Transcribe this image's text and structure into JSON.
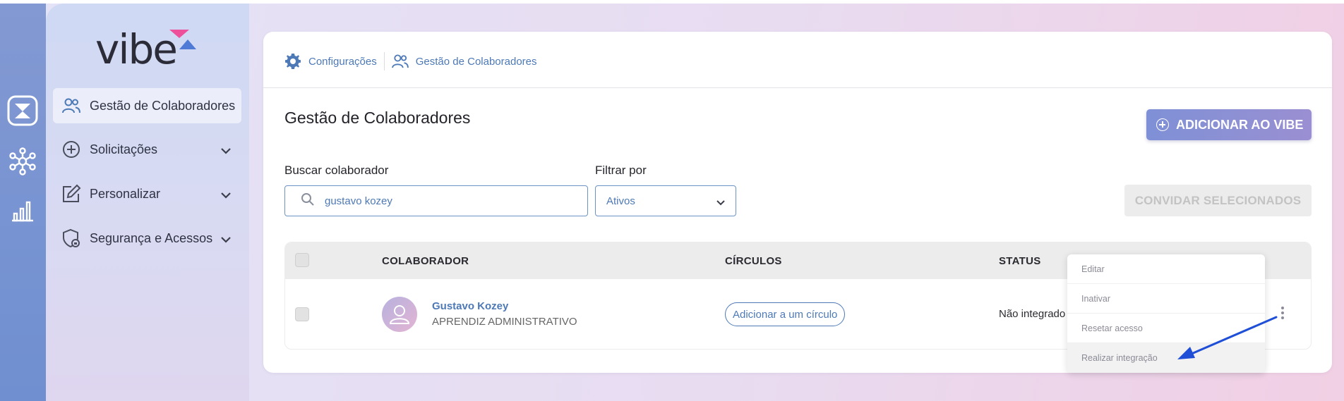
{
  "brand": {
    "logo_text": "vibe"
  },
  "colors": {
    "accent": "#4d79b7",
    "rail": "#7b93d1",
    "primary_button": "#8a90d5",
    "annotation_arrow": "#1f4fd6"
  },
  "rail": {
    "icons": [
      "vibe-hourglass-icon",
      "network-icon",
      "bar-chart-icon"
    ]
  },
  "sidebar": {
    "items": [
      {
        "label": "Gestão de Colaboradores",
        "icon": "users-icon",
        "active": true
      },
      {
        "label": "Solicitações",
        "icon": "plus-circle-icon",
        "expandable": true
      },
      {
        "label": "Personalizar",
        "icon": "edit-icon",
        "expandable": true
      },
      {
        "label": "Segurança e Acessos",
        "icon": "shield-lock-icon",
        "expandable": true
      }
    ]
  },
  "breadcrumb": [
    {
      "label": "Configurações",
      "icon": "gear-icon"
    },
    {
      "label": "Gestão de Colaboradores",
      "icon": "users-icon"
    }
  ],
  "page": {
    "title": "Gestão de Colaboradores",
    "add_button": "ADICIONAR AO VIBE",
    "invite_button": "CONVIDAR SELECIONADOS"
  },
  "search": {
    "label": "Buscar colaborador",
    "value": "gustavo kozey"
  },
  "filter": {
    "label": "Filtrar por",
    "selected": "Ativos"
  },
  "table": {
    "headers": [
      "COLABORADOR",
      "CÍRCULOS",
      "STATUS"
    ],
    "rows": [
      {
        "name": "Gustavo Kozey",
        "role": "APRENDIZ ADMINISTRATIVO",
        "circle_action": "Adicionar a um círculo",
        "status": "Não integrado"
      }
    ]
  },
  "row_menu": {
    "items": [
      "Editar",
      "Inativar",
      "Resetar acesso",
      "Realizar integração"
    ]
  }
}
